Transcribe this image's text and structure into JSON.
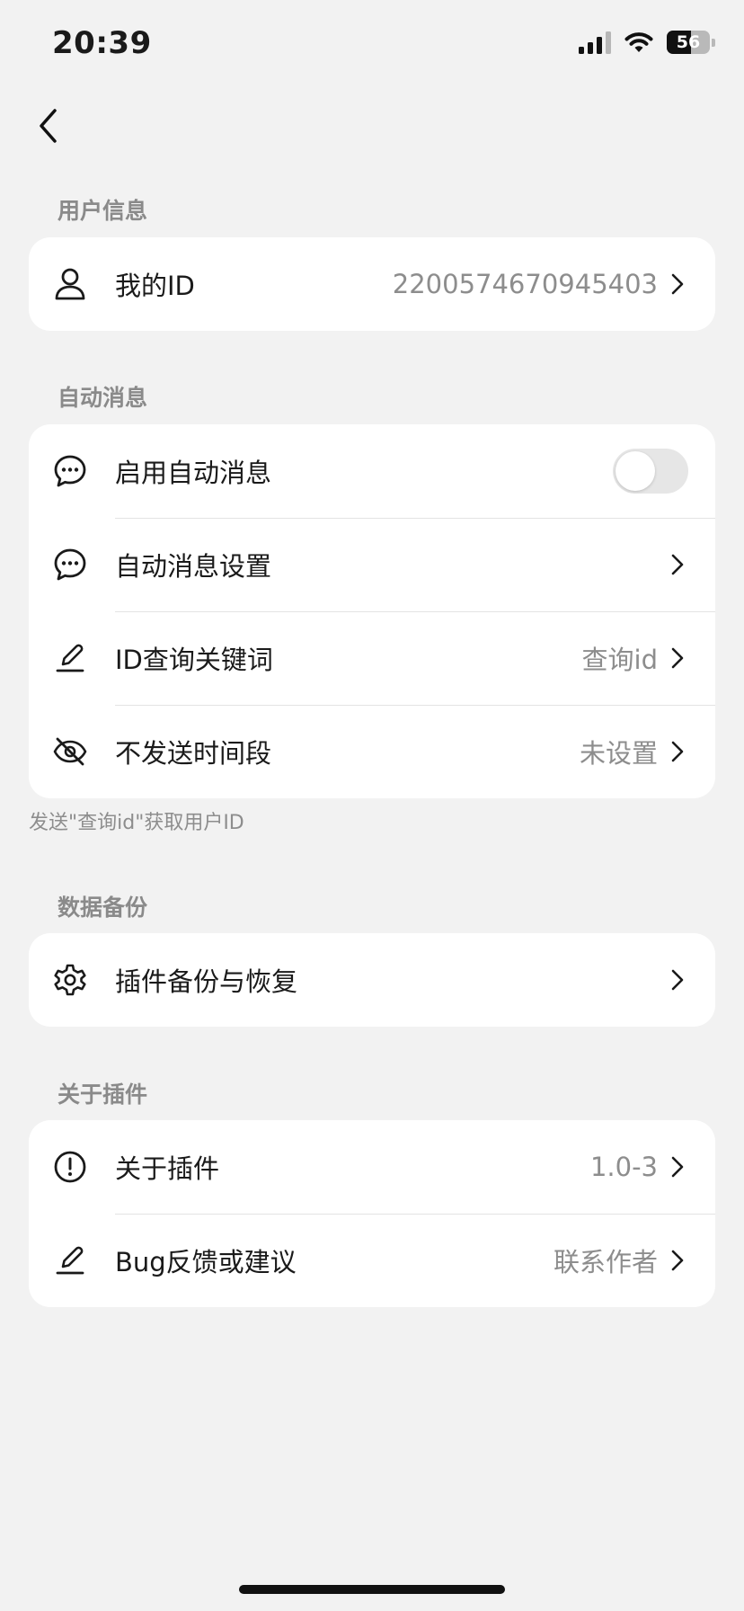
{
  "status_bar": {
    "time": "20:39",
    "battery_level": "56",
    "icons": [
      "signal-icon",
      "wifi-icon",
      "battery-icon"
    ]
  },
  "nav": {
    "back_icon": "chevron-left-icon"
  },
  "sections": {
    "user_info": {
      "title": "用户信息",
      "my_id": {
        "icon": "user-icon",
        "label": "我的ID",
        "value": "2200574670945403"
      }
    },
    "auto_message": {
      "title": "自动消息",
      "enable": {
        "icon": "chat-bubble-icon",
        "label": "启用自动消息",
        "toggle_on": false
      },
      "settings": {
        "icon": "chat-bubble-icon",
        "label": "自动消息设置"
      },
      "keyword": {
        "icon": "pencil-icon",
        "label": "ID查询关键词",
        "value": "查询id"
      },
      "quiet_hours": {
        "icon": "eye-off-icon",
        "label": "不发送时间段",
        "value": "未设置"
      },
      "footnote": "发送\"查询id\"获取用户ID"
    },
    "backup": {
      "title": "数据备份",
      "backup_restore": {
        "icon": "gear-icon",
        "label": "插件备份与恢复"
      }
    },
    "about": {
      "title": "关于插件",
      "about_plugin": {
        "icon": "info-circle-icon",
        "label": "关于插件",
        "value": "1.0-3"
      },
      "feedback": {
        "icon": "pencil-icon",
        "label": "Bug反馈或建议",
        "value": "联系作者"
      }
    }
  },
  "colors": {
    "background": "#f2f2f2",
    "card": "#ffffff",
    "text_primary": "#1a1a1a",
    "text_secondary": "#8d8d8d",
    "divider": "#e3e3e3",
    "toggle_off": "#e6e6e6"
  }
}
